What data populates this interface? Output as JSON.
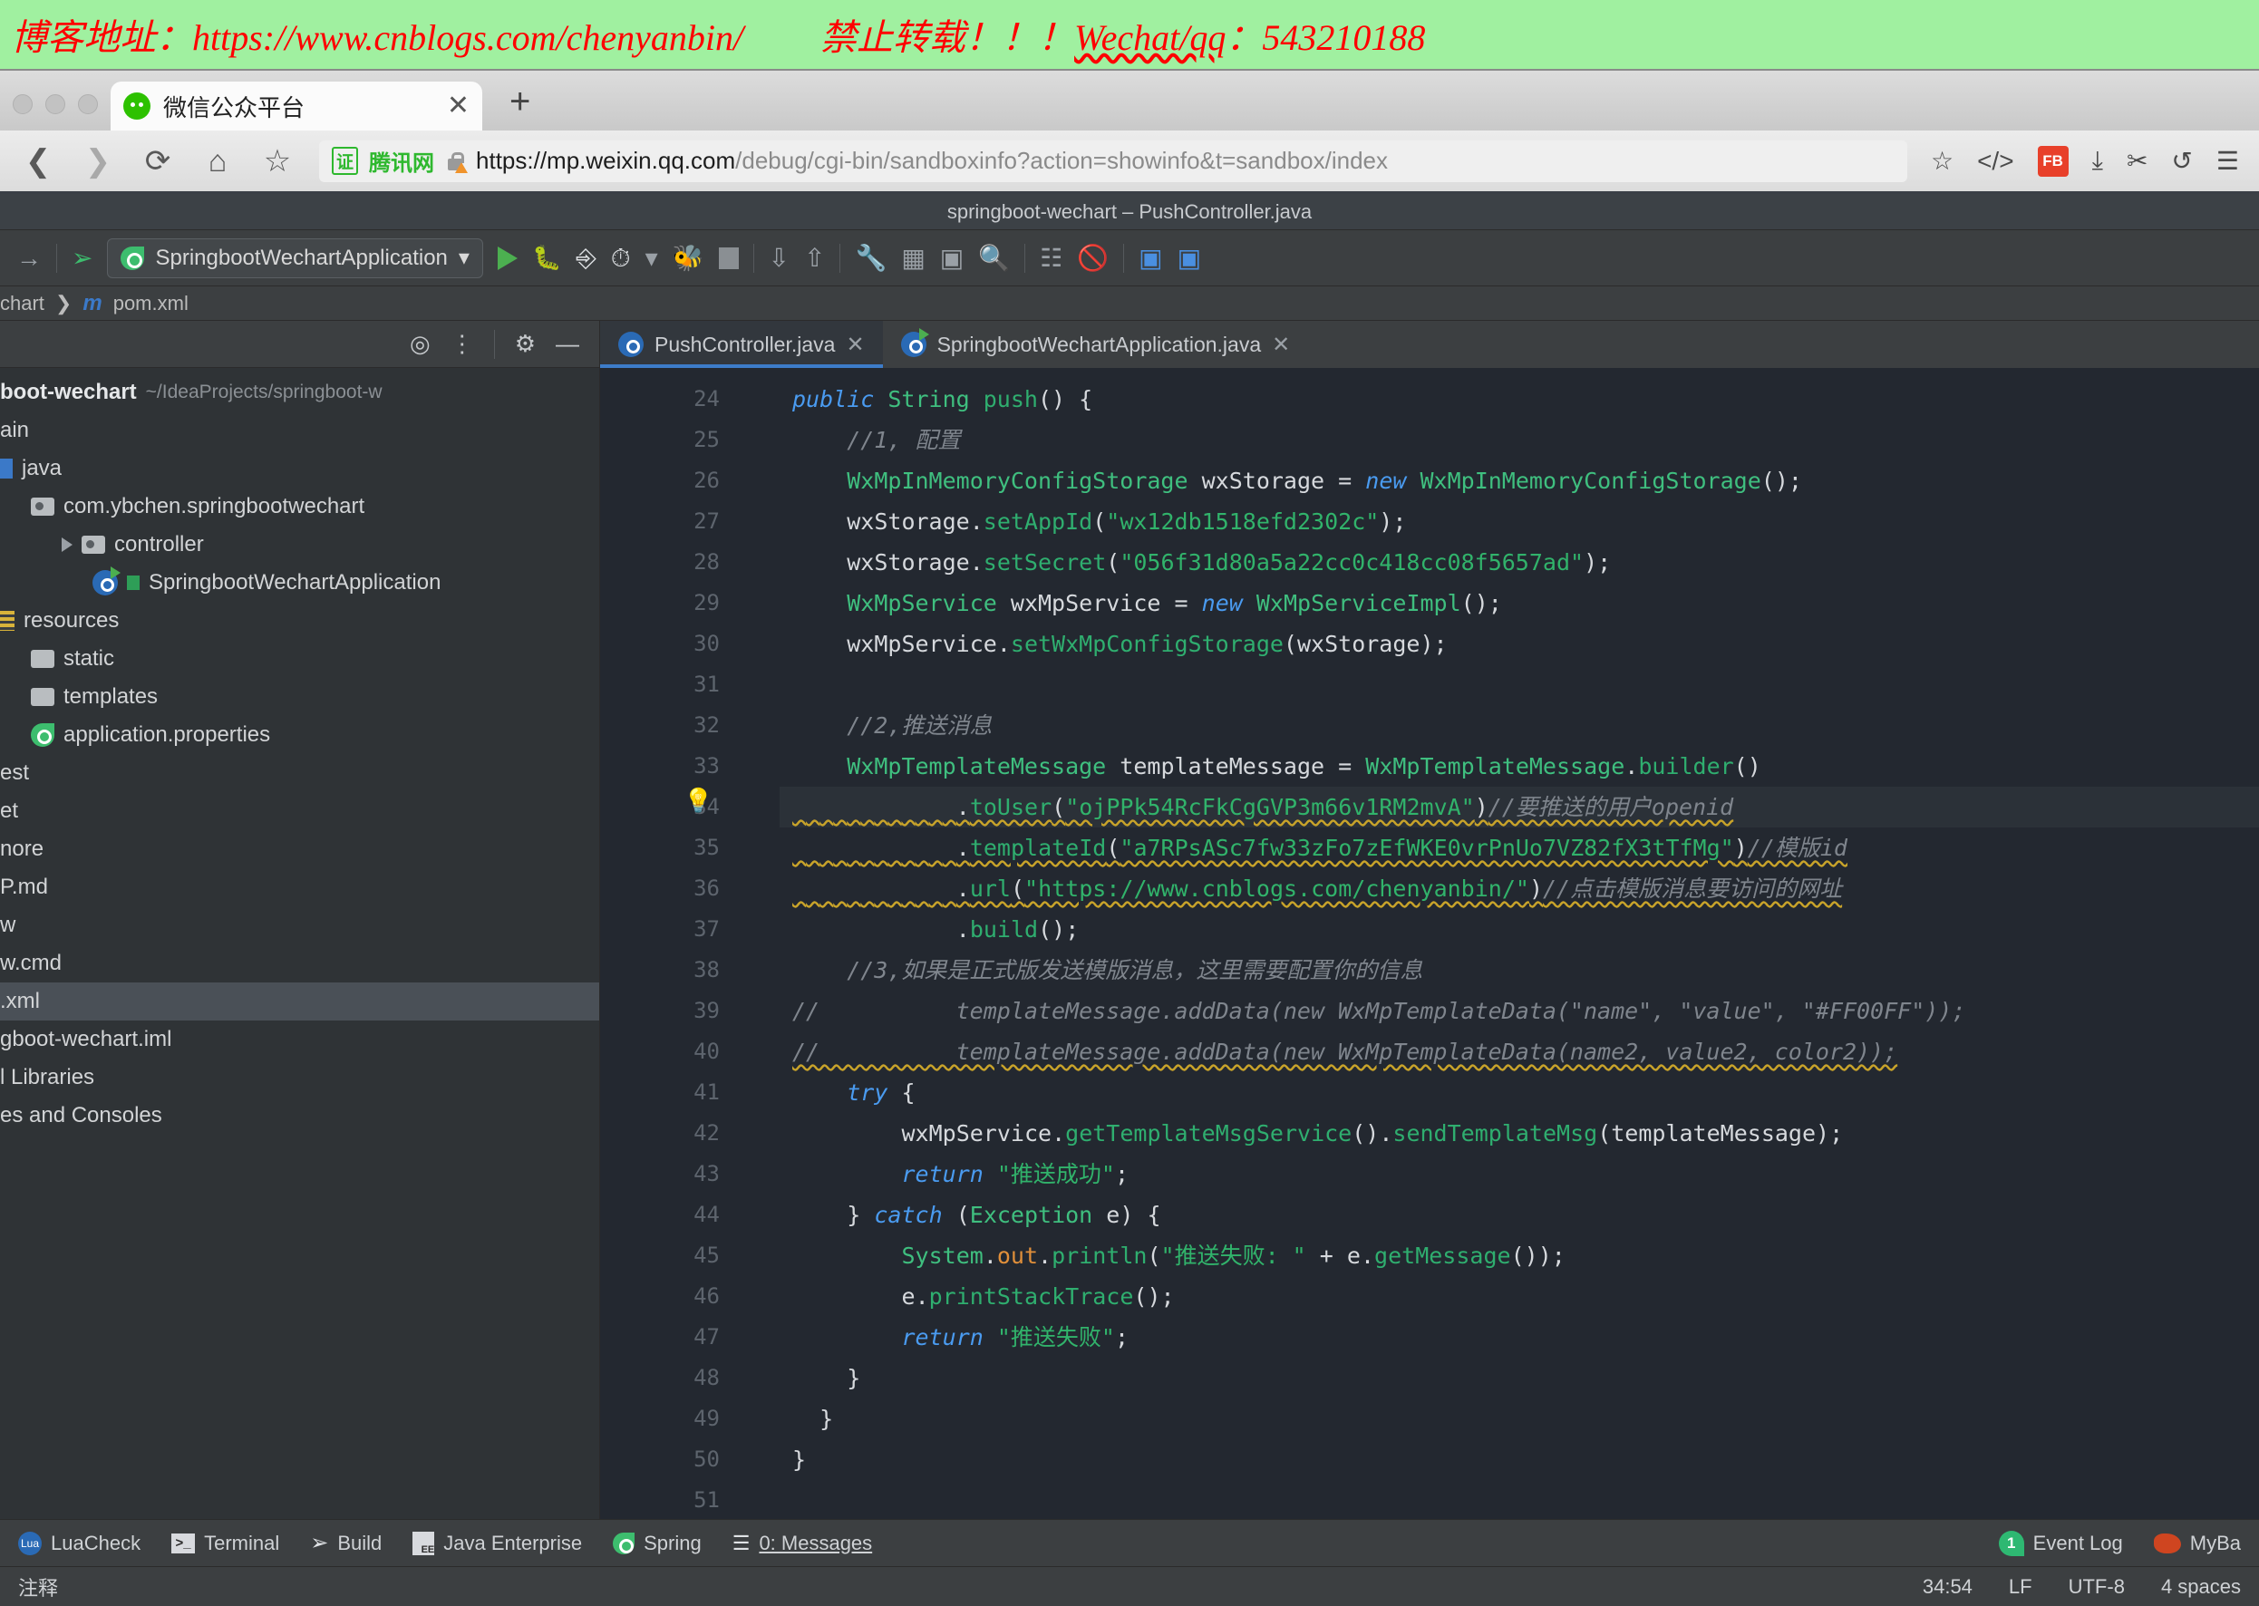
{
  "banner": {
    "left_text": "博客地址：https://www.cnblogs.com/chenyanbin/",
    "right_prefix": "禁止转载！！！",
    "right_link": "Wechat/qq",
    "right_suffix": "：543210188",
    "bg_color": "#a0f0a0",
    "text_color": "#ff0000"
  },
  "browser": {
    "tab": {
      "title": "微信公众平台",
      "close_label": "✕",
      "favicon": "wechat-icon"
    },
    "new_tab_label": "+",
    "nav": {
      "back": "❮",
      "forward": "❯",
      "reload": "⟳",
      "home": "⌂",
      "bookmark": "☆"
    },
    "omnibox": {
      "cert_badge": "证",
      "site_name": "腾讯网",
      "url_bold": "https://mp.weixin.qq.com",
      "url_rest": "/debug/cgi-bin/sandboxinfo?action=showinfo&t=sandbox/index"
    },
    "right_icons": [
      "star-icon",
      "code-icon",
      "extension-icon",
      "download-icon",
      "scissors-icon",
      "undo-icon",
      "menu-icon"
    ],
    "right_labels": {
      "star": "☆",
      "code": "</>",
      "extension": "FB",
      "download": "⤓",
      "scissors": "✂",
      "undo": "↺",
      "menu": "☰"
    }
  },
  "ide": {
    "window_title": "springboot-wechart – PushController.java",
    "toolbar": {
      "forward_arrow": "→",
      "build_icon": "hammer-icon",
      "run_config": "SpringbootWechartApplication",
      "dropdown_caret": "▾",
      "run": "▶",
      "debug": "debug-icon",
      "run_coverage": "coverage-icon",
      "profile": "profile-icon",
      "attach": "attach-icon",
      "stop": "stop-icon",
      "icons": [
        "update-icon",
        "sync-icon",
        "settings-icon",
        "structure-icon",
        "terminal-icon",
        "search-icon",
        "chart-icon",
        "disable-icon",
        "translate-icon",
        "translate2-icon"
      ]
    },
    "breadcrumb": {
      "project": "chart",
      "separator": "❯",
      "maven_icon": "m",
      "file": "pom.xml"
    },
    "project_panel": {
      "header_icons": [
        "locate-icon",
        "collapse-icon",
        "gear-icon",
        "minimize-icon"
      ],
      "root": {
        "name": "boot-wechart",
        "path": "~/IdeaProjects/springboot-w"
      },
      "items": [
        {
          "label": "ain",
          "indent": 0,
          "icon": "none",
          "arrow": false,
          "selected": false
        },
        {
          "label": "java",
          "indent": 0,
          "icon": "bluebar",
          "arrow": false,
          "selected": false
        },
        {
          "label": "com.ybchen.springbootwechart",
          "indent": 1,
          "icon": "package",
          "arrow": false,
          "selected": false
        },
        {
          "label": "controller",
          "indent": 2,
          "icon": "package",
          "arrow": true,
          "selected": false
        },
        {
          "label": "SpringbootWechartApplication",
          "indent": 3,
          "icon": "class-run",
          "arrow": false,
          "selected": false
        },
        {
          "label": "resources",
          "indent": 0,
          "icon": "resources",
          "arrow": false,
          "selected": false
        },
        {
          "label": "static",
          "indent": 1,
          "icon": "folder",
          "arrow": false,
          "selected": false
        },
        {
          "label": "templates",
          "indent": 1,
          "icon": "folder",
          "arrow": false,
          "selected": false
        },
        {
          "label": "application.properties",
          "indent": 1,
          "icon": "spring",
          "arrow": false,
          "selected": false
        },
        {
          "label": "est",
          "indent": 0,
          "icon": "none",
          "arrow": false,
          "selected": false
        },
        {
          "label": "et",
          "indent": 0,
          "icon": "none",
          "arrow": false,
          "selected": false
        },
        {
          "label": "nore",
          "indent": 0,
          "icon": "none",
          "arrow": false,
          "selected": false
        },
        {
          "label": "P.md",
          "indent": 0,
          "icon": "none",
          "arrow": false,
          "selected": false
        },
        {
          "label": "w",
          "indent": 0,
          "icon": "none",
          "arrow": false,
          "selected": false
        },
        {
          "label": "w.cmd",
          "indent": 0,
          "icon": "none",
          "arrow": false,
          "selected": false
        },
        {
          "label": ".xml",
          "indent": 0,
          "icon": "none",
          "arrow": false,
          "selected": true
        },
        {
          "label": "gboot-wechart.iml",
          "indent": 0,
          "icon": "none",
          "arrow": false,
          "selected": false
        },
        {
          "label": "l Libraries",
          "indent": 0,
          "icon": "none",
          "arrow": false,
          "selected": false
        },
        {
          "label": "es and Consoles",
          "indent": 0,
          "icon": "none",
          "arrow": false,
          "selected": false
        }
      ]
    },
    "editor_tabs": [
      {
        "label": "PushController.java",
        "close": "✕",
        "active": true,
        "icon": "java-class-icon"
      },
      {
        "label": "SpringbootWechartApplication.java",
        "close": "✕",
        "active": false,
        "icon": "spring-class-icon"
      }
    ],
    "code": {
      "first_line": 24,
      "lines": [
        {
          "n": 24,
          "state": "normal"
        },
        {
          "n": 25,
          "state": "normal"
        },
        {
          "n": 26,
          "state": "normal"
        },
        {
          "n": 27,
          "state": "normal"
        },
        {
          "n": 28,
          "state": "normal"
        },
        {
          "n": 29,
          "state": "normal"
        },
        {
          "n": 30,
          "state": "normal"
        },
        {
          "n": 31,
          "state": "normal"
        },
        {
          "n": 32,
          "state": "normal"
        },
        {
          "n": 33,
          "state": "normal"
        },
        {
          "n": 34,
          "state": "highlight"
        },
        {
          "n": 35,
          "state": "normal"
        },
        {
          "n": 36,
          "state": "normal"
        },
        {
          "n": 37,
          "state": "normal"
        },
        {
          "n": 38,
          "state": "normal"
        },
        {
          "n": 39,
          "state": "normal"
        },
        {
          "n": 40,
          "state": "normal"
        },
        {
          "n": 41,
          "state": "normal"
        },
        {
          "n": 42,
          "state": "normal"
        },
        {
          "n": 43,
          "state": "normal"
        },
        {
          "n": 44,
          "state": "normal"
        },
        {
          "n": 45,
          "state": "normal"
        },
        {
          "n": 46,
          "state": "normal"
        },
        {
          "n": 47,
          "state": "normal"
        },
        {
          "n": 48,
          "state": "normal"
        },
        {
          "n": 49,
          "state": "normal"
        },
        {
          "n": 50,
          "state": "normal"
        },
        {
          "n": 51,
          "state": "normal"
        }
      ],
      "text": [
        "public String push() {",
        "    //1, 配置",
        "    WxMpInMemoryConfigStorage wxStorage = new WxMpInMemoryConfigStorage();",
        "    wxStorage.setAppId(\"wx12db1518efd2302c\");",
        "    wxStorage.setSecret(\"056f31d80a5a22cc0c418cc08f5657ad\");",
        "    WxMpService wxMpService = new WxMpServiceImpl();",
        "    wxMpService.setWxMpConfigStorage(wxStorage);",
        "",
        "    //2,推送消息",
        "    WxMpTemplateMessage templateMessage = WxMpTemplateMessage.builder()",
        "            .toUser(\"ojPPk54RcFkCgGVP3m66v1RM2mvA\")//要推送的用户openid",
        "            .templateId(\"a7RPsASc7fw33zFo7zEfWKE0vrPnUo7VZ82fX3tTfMg\")//模版id",
        "            .url(\"https://www.cnblogs.com/chenyanbin/\")//点击模版消息要访问的网址",
        "            .build();",
        "    //3,如果是正式版发送模版消息，这里需要配置你的信息",
        "//          templateMessage.addData(new WxMpTemplateData(\"name\", \"value\", \"#FF00FF\"));",
        "//          templateMessage.addData(new WxMpTemplateData(name2, value2, color2));",
        "    try {",
        "        wxMpService.getTemplateMsgService().sendTemplateMsg(templateMessage);",
        "        return \"推送成功\";",
        "    } catch (Exception e) {",
        "        System.out.println(\"推送失败: \" + e.getMessage());",
        "        e.printStackTrace();",
        "        return \"推送失败\";",
        "    }",
        "  }",
        "}",
        ""
      ]
    },
    "tool_window_bar": [
      {
        "label": "LuaCheck",
        "icon": "lua-icon"
      },
      {
        "label": "Terminal",
        "icon": "terminal-icon"
      },
      {
        "label": "Build",
        "icon": "hammer-icon"
      },
      {
        "label": "Java Enterprise",
        "icon": "jee-icon"
      },
      {
        "label": "Spring",
        "icon": "spring-leaf-icon"
      },
      {
        "label": "0: Messages",
        "icon": "messages-icon"
      }
    ],
    "tool_window_right": [
      {
        "label": "Event Log",
        "icon": "event-badge",
        "badge": "1"
      },
      {
        "label": "MyBa",
        "icon": "mybatis-icon"
      }
    ],
    "status_bar": {
      "hint": "注释",
      "caret": "34:54",
      "line_sep": "LF",
      "encoding": "UTF-8",
      "indent": "4 spaces"
    }
  }
}
